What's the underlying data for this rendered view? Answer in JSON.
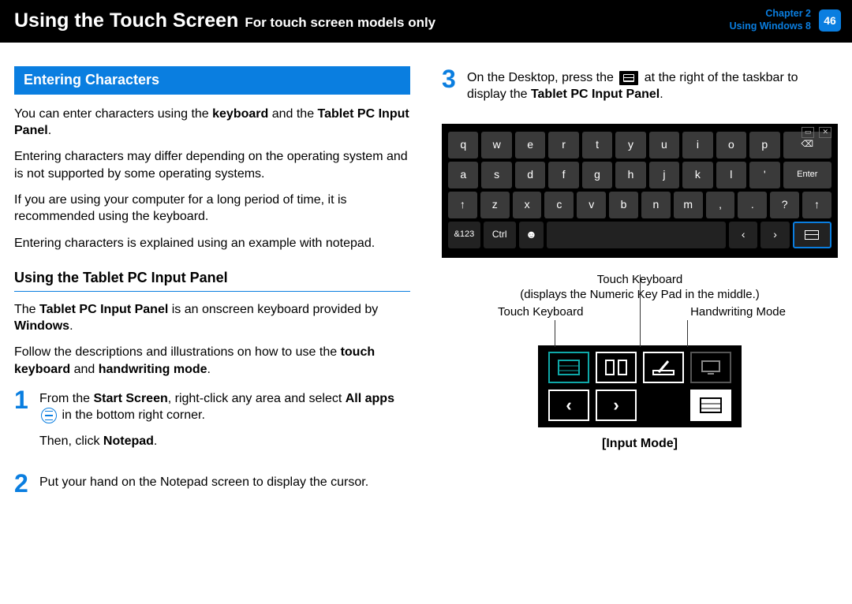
{
  "header": {
    "title_main": "Using the Touch Screen",
    "title_sub": "For touch screen models only",
    "chapter_line1": "Chapter 2",
    "chapter_line2": "Using Windows 8",
    "page_number": "46"
  },
  "left": {
    "section_title": "Entering Characters",
    "intro_1a": "You can enter characters using the ",
    "intro_1b": "keyboard",
    "intro_1c": " and the ",
    "intro_1d": "Tablet PC Input Panel",
    "intro_1e": ".",
    "intro_2": "Entering characters may differ depending on the operating system and is not supported by some operating systems.",
    "intro_3": "If you are using your computer for a long period of time, it is recommended using the keyboard.",
    "intro_4": "Entering characters is explained using an example with notepad.",
    "sub_heading": "Using the Tablet PC Input Panel",
    "sub_1a": "The ",
    "sub_1b": "Tablet PC Input Panel",
    "sub_1c": " is an onscreen keyboard provided by ",
    "sub_1d": "Windows",
    "sub_1e": ".",
    "sub_2a": "Follow the descriptions and illustrations on how to use the ",
    "sub_2b": "touch keyboard",
    "sub_2c": " and ",
    "sub_2d": "handwriting mode",
    "sub_2e": ".",
    "step1_num": "1",
    "step1_a": "From the ",
    "step1_b": "Start Screen",
    "step1_c": ", right-click any area and select ",
    "step1_d": "All apps",
    "step1_e": " in the bottom right corner.",
    "step1_f": "Then, click ",
    "step1_g": "Notepad",
    "step1_h": ".",
    "step2_num": "2",
    "step2_text": "Put your hand on the Notepad screen to display the cursor."
  },
  "right": {
    "step3_num": "3",
    "step3_a": "On the Desktop, press the ",
    "step3_b": " at the right of the taskbar to display the ",
    "step3_c": "Tablet PC Input Panel",
    "step3_d": ".",
    "label_touch_kb_num": "Touch Keyboard",
    "label_touch_kb_num_sub": "(displays the Numeric Key Pad in the middle.)",
    "label_touch_kb": "Touch Keyboard",
    "label_handwriting": "Handwriting Mode",
    "input_mode": "[Input Mode]"
  },
  "keyboard": {
    "row1": [
      "q",
      "w",
      "e",
      "r",
      "t",
      "y",
      "u",
      "i",
      "o",
      "p"
    ],
    "row2": [
      "a",
      "s",
      "d",
      "f",
      "g",
      "h",
      "j",
      "k",
      "l",
      "'"
    ],
    "enter": "Enter",
    "shift": "↑",
    "row3": [
      "z",
      "x",
      "c",
      "v",
      "b",
      "n",
      "m",
      ",",
      ".",
      "?"
    ],
    "num": "&123",
    "ctrl": "Ctrl",
    "left": "‹",
    "right": "›"
  }
}
